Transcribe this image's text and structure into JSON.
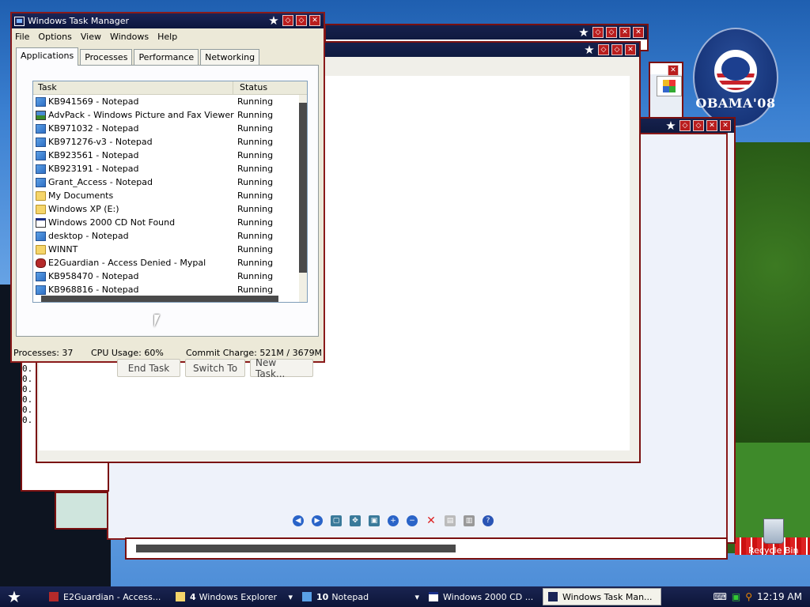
{
  "colors": {
    "title_bar": "#0f1a40",
    "window_border": "#8a1a1a",
    "button_red": "#b91d1d",
    "taskbar": "#1a2452",
    "dialog_face": "#ece9d8"
  },
  "desktop": {
    "poster_text": "OBAMA'08",
    "recycle_bin_label": "Recycle Bin",
    "notepad_lines": [
      "0.",
      "0.",
      "0.",
      "0.",
      "0.",
      "0."
    ]
  },
  "task_manager": {
    "title": "Windows Task Manager",
    "menu": [
      "File",
      "Options",
      "View",
      "Windows",
      "Help"
    ],
    "tabs": [
      "Applications",
      "Processes",
      "Performance",
      "Networking"
    ],
    "active_tab": "Applications",
    "columns": {
      "task": "Task",
      "status": "Status"
    },
    "tasks": [
      {
        "name": "KB941569 - Notepad",
        "status": "Running",
        "icon": "notepad-icon"
      },
      {
        "name": "AdvPack - Windows Picture and Fax Viewer",
        "status": "Running",
        "icon": "picture-viewer-icon"
      },
      {
        "name": "KB971032 - Notepad",
        "status": "Running",
        "icon": "notepad-icon"
      },
      {
        "name": "KB971276-v3 - Notepad",
        "status": "Running",
        "icon": "notepad-icon"
      },
      {
        "name": "KB923561 - Notepad",
        "status": "Running",
        "icon": "notepad-icon"
      },
      {
        "name": "KB923191 - Notepad",
        "status": "Running",
        "icon": "notepad-icon"
      },
      {
        "name": "Grant_Access - Notepad",
        "status": "Running",
        "icon": "notepad-icon"
      },
      {
        "name": "My Documents",
        "status": "Running",
        "icon": "folder-icon"
      },
      {
        "name": "Windows XP (E:)",
        "status": "Running",
        "icon": "folder-icon"
      },
      {
        "name": "Windows 2000 CD Not Found",
        "status": "Running",
        "icon": "window-icon"
      },
      {
        "name": "desktop - Notepad",
        "status": "Running",
        "icon": "notepad-icon"
      },
      {
        "name": "WINNT",
        "status": "Running",
        "icon": "folder-icon"
      },
      {
        "name": "E2Guardian - Access Denied - Mypal",
        "status": "Running",
        "icon": "browser-icon"
      },
      {
        "name": "KB958470 - Notepad",
        "status": "Running",
        "icon": "notepad-icon"
      },
      {
        "name": "KB968816 - Notepad",
        "status": "Running",
        "icon": "notepad-icon"
      }
    ],
    "buttons": {
      "end_task": "End Task",
      "switch_to": "Switch To",
      "new_task": "New Task..."
    },
    "status_bar": {
      "processes": "Processes: 37",
      "cpu": "CPU Usage: 60%",
      "commit": "Commit Charge: 521M / 3679M"
    }
  },
  "taskbar": {
    "items": [
      {
        "label": "E2Guardian - Access...",
        "icon": "browser-icon",
        "count": ""
      },
      {
        "label": "Windows Explorer",
        "icon": "folder-icon",
        "count": "4"
      },
      {
        "label": "Notepad",
        "icon": "notepad-icon",
        "count": "10"
      },
      {
        "label": "Windows 2000 CD ...",
        "icon": "window-icon",
        "count": ""
      },
      {
        "label": "Windows Task Man...",
        "icon": "task-manager-icon",
        "count": ""
      }
    ],
    "clock": "12:19 AM"
  }
}
